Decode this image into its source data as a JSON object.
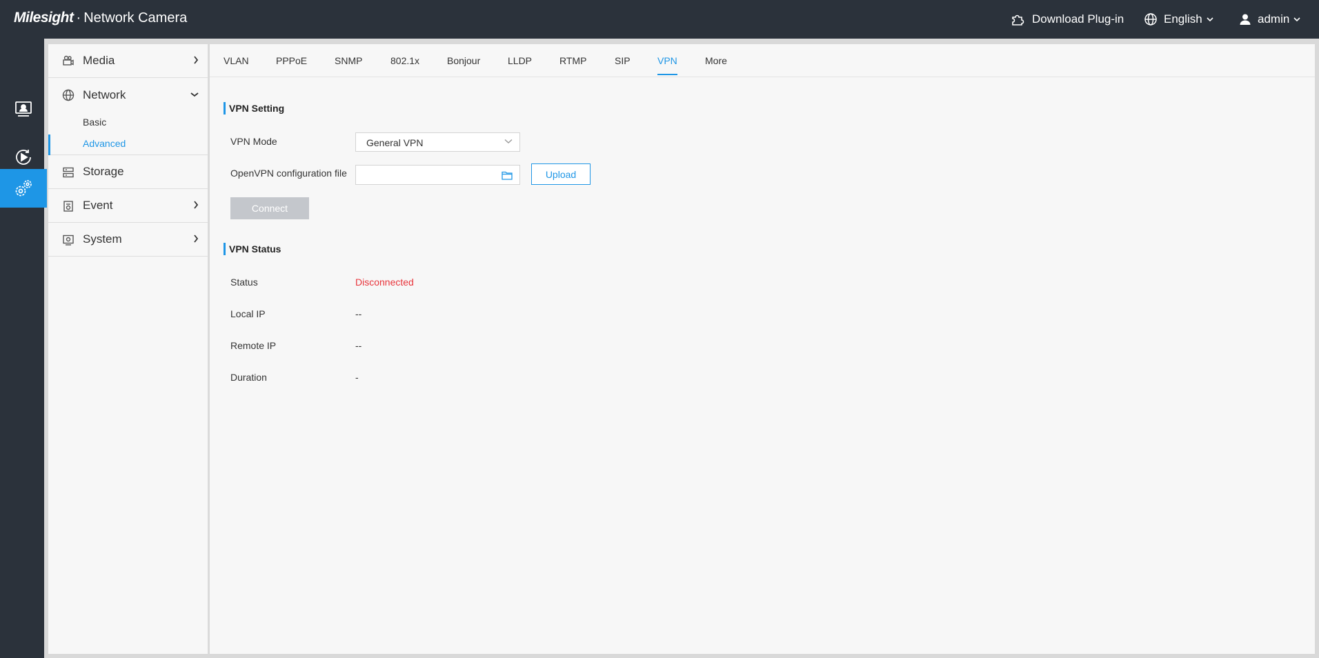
{
  "header": {
    "brand": "Milesight",
    "separator": "·",
    "product": "Network Camera",
    "download_label": "Download Plug-in",
    "language_label": "English",
    "user_label": "admin"
  },
  "rail": {
    "items": [
      {
        "icon": "live-view-monitor-icon"
      },
      {
        "icon": "playback-icon"
      },
      {
        "icon": "settings-gears-icon"
      }
    ]
  },
  "sidebar": {
    "items": [
      {
        "label": "Media",
        "icon": "camera-icon"
      },
      {
        "label": "Network",
        "icon": "globe-icon"
      },
      {
        "label": "Storage",
        "icon": "storage-icon"
      },
      {
        "label": "Event",
        "icon": "event-icon"
      },
      {
        "label": "System",
        "icon": "system-icon"
      }
    ],
    "network_sub": [
      {
        "label": "Basic"
      },
      {
        "label": "Advanced"
      }
    ]
  },
  "tabs": [
    {
      "label": "VLAN"
    },
    {
      "label": "PPPoE"
    },
    {
      "label": "SNMP"
    },
    {
      "label": "802.1x"
    },
    {
      "label": "Bonjour"
    },
    {
      "label": "LLDP"
    },
    {
      "label": "RTMP"
    },
    {
      "label": "SIP"
    },
    {
      "label": "VPN"
    },
    {
      "label": "More"
    }
  ],
  "vpn_setting": {
    "title": "VPN Setting",
    "mode_label": "VPN Mode",
    "mode_value": "General VPN",
    "config_label": "OpenVPN configuration file",
    "config_value": "",
    "upload_label": "Upload",
    "connect_label": "Connect"
  },
  "vpn_status": {
    "title": "VPN Status",
    "rows": [
      {
        "label": "Status",
        "value": "Disconnected"
      },
      {
        "label": "Local IP",
        "value": "--"
      },
      {
        "label": "Remote IP",
        "value": "--"
      },
      {
        "label": "Duration",
        "value": "-"
      }
    ]
  },
  "colors": {
    "accent": "#1e96e6",
    "topbar": "#2b323b",
    "error": "#e8343b",
    "disabled_button": "#c4c7cc"
  }
}
